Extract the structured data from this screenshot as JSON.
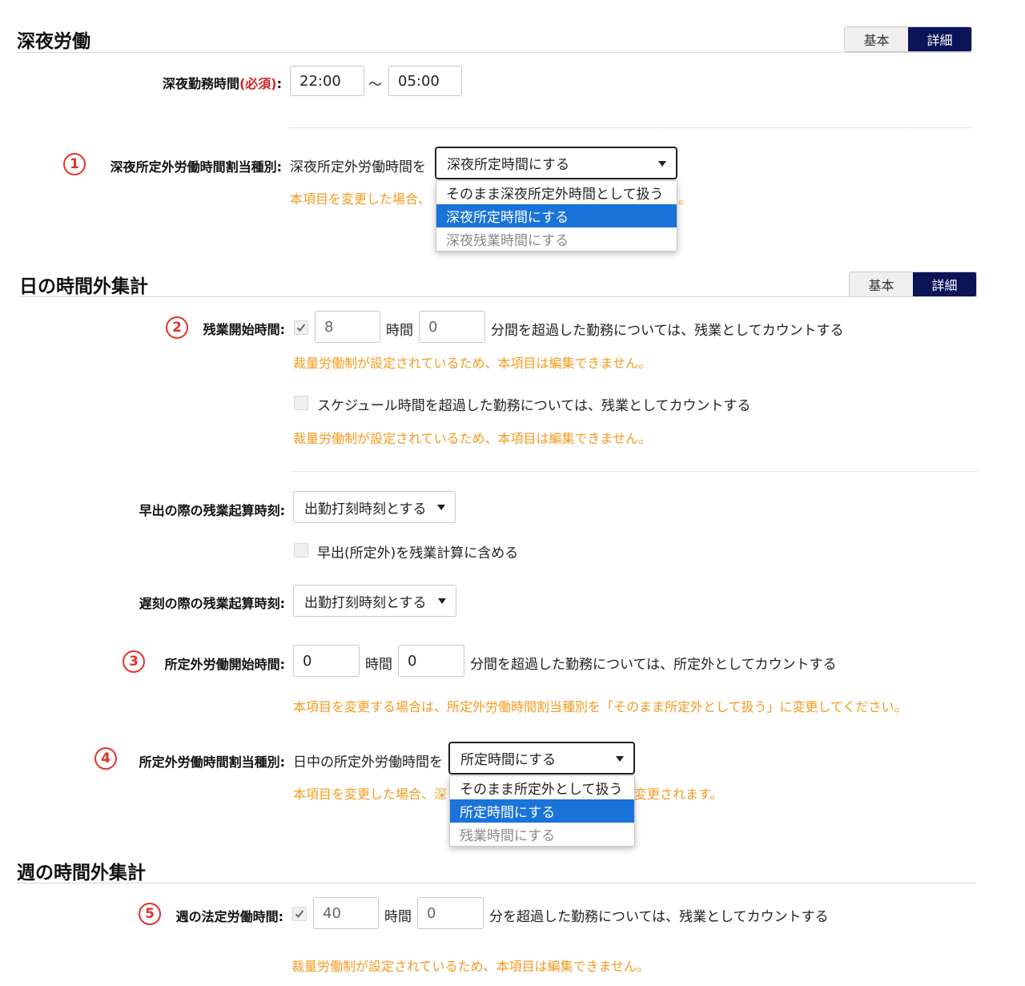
{
  "night": {
    "title": "深夜労働",
    "toggle": {
      "basic": "基本",
      "detail": "詳細"
    },
    "hours_label": "深夜勤務時間",
    "required": "(必須)",
    "colon": ":",
    "start": "22:00",
    "tilde": "～",
    "end": "05:00",
    "alloc_num": "1",
    "alloc_label": "深夜所定外労働時間割当種別:",
    "alloc_prefix": "深夜所定外労働時間を",
    "alloc_selected": "深夜所定時間にする",
    "alloc_warning": "本項目を変更した場合、",
    "alloc_warning_tail": "。",
    "alloc_options": [
      "そのまま深夜所定外時間として扱う",
      "深夜所定時間にする",
      "深夜残業時間にする"
    ]
  },
  "daily": {
    "title": "日の時間外集計",
    "toggle": {
      "basic": "基本",
      "detail": "詳細"
    },
    "ot_num": "2",
    "ot_label": "残業開始時間:",
    "ot_hours": "8",
    "hours_unit": "時間",
    "ot_minutes": "0",
    "ot_suffix": "分間を超過した勤務については、残業としてカウントする",
    "locked_warning": "裁量労働制が設定されているため、本項目は編集できません。",
    "schedule_label": "スケジュール時間を超過した勤務については、残業としてカウントする",
    "early_label": "早出の際の残業起算時刻:",
    "early_value": "出勤打刻時刻とする",
    "early_include": "早出(所定外)を残業計算に含める",
    "late_label": "遅刻の際の残業起算時刻:",
    "late_value": "出勤打刻時刻とする",
    "nonsched_num": "3",
    "nonsched_label": "所定外労働開始時間:",
    "nonsched_hours": "0",
    "nonsched_minutes": "0",
    "nonsched_suffix": "分間を超過した勤務については、所定外としてカウントする",
    "nonsched_warning": "本項目を変更する場合は、所定外労働時間割当種別を「そのまま所定外として扱う」に変更してください。",
    "alloc_num": "4",
    "alloc_label": "所定外労働時間割当種別:",
    "alloc_prefix": "日中の所定外労働時間を",
    "alloc_selected": "所定時間にする",
    "alloc_warning": "本項目を変更した場合、深",
    "alloc_warning_tail": "変更されます。",
    "alloc_options": [
      "そのまま所定外として扱う",
      "所定時間にする",
      "残業時間にする"
    ]
  },
  "weekly": {
    "title": "週の時間外集計",
    "legal_num": "5",
    "legal_label": "週の法定労働時間:",
    "legal_hours": "40",
    "hours_unit": "時間",
    "legal_minutes": "0",
    "legal_suffix": "分を超過した勤務については、残業としてカウントする",
    "locked_warning": "裁量労働制が設定されているため、本項目は編集できません。"
  }
}
